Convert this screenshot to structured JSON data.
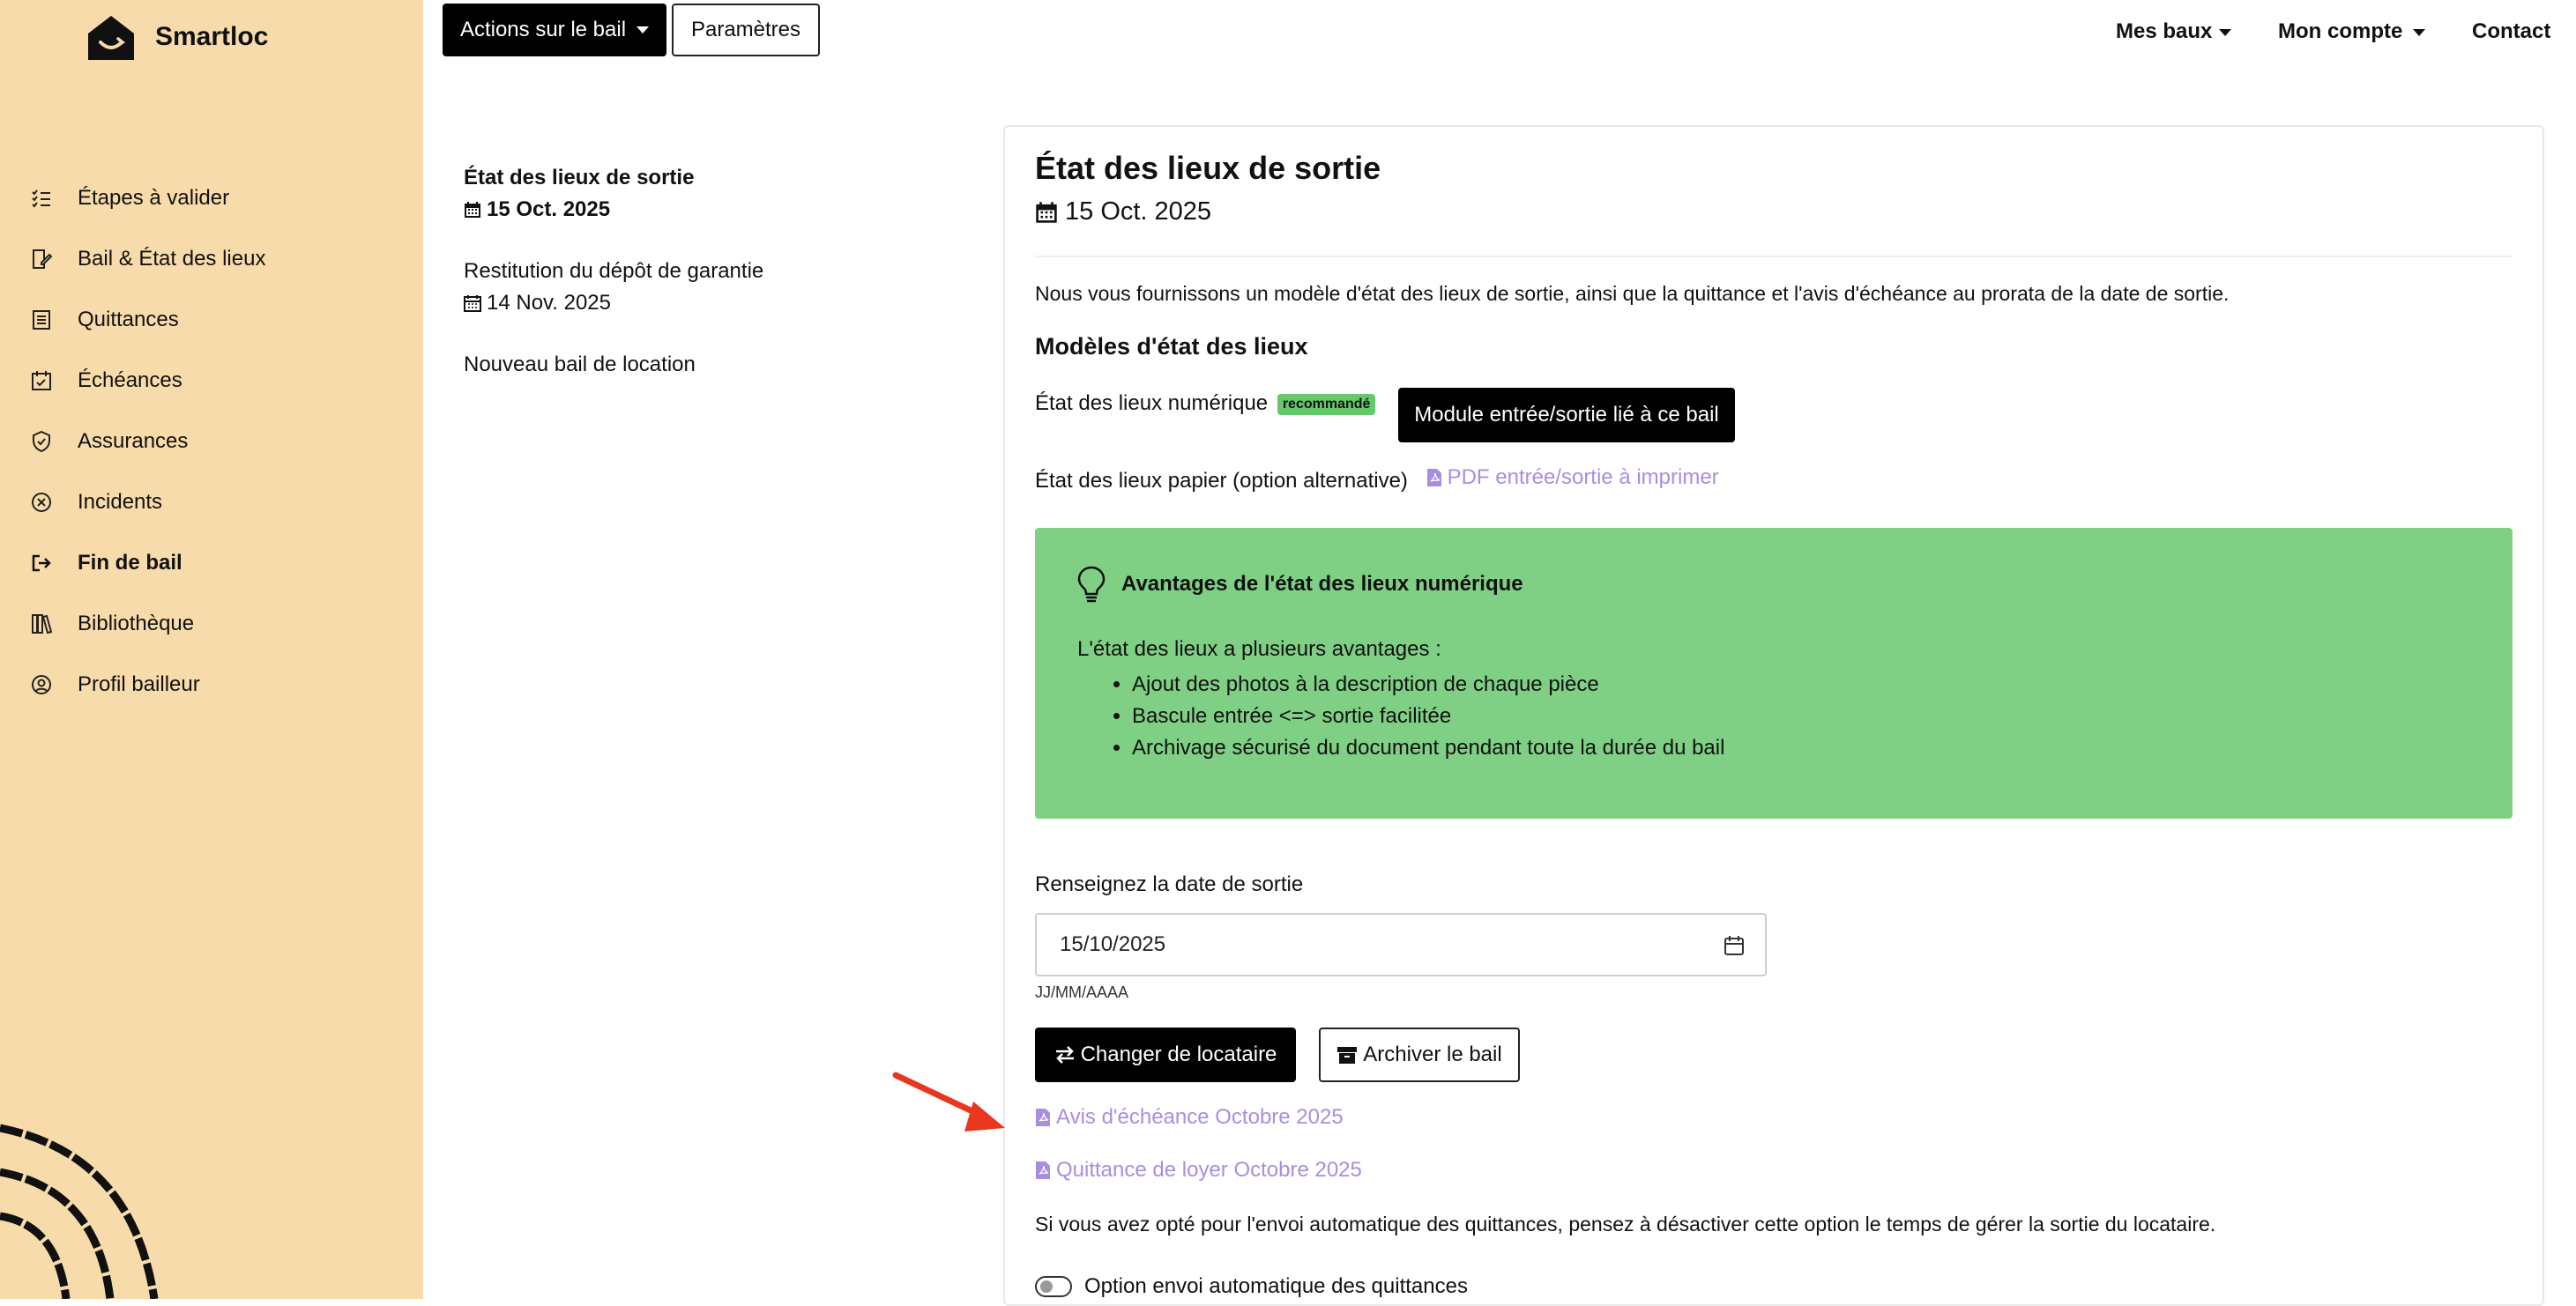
{
  "brand": {
    "name": "Smartloc"
  },
  "sidebar": {
    "items": [
      {
        "label": "Étapes à valider",
        "icon": "checklist-icon"
      },
      {
        "label": "Bail & État des lieux",
        "icon": "edit-document-icon"
      },
      {
        "label": "Quittances",
        "icon": "receipt-icon"
      },
      {
        "label": "Échéances",
        "icon": "calendar-check-icon"
      },
      {
        "label": "Assurances",
        "icon": "shield-icon"
      },
      {
        "label": "Incidents",
        "icon": "x-circle-icon"
      },
      {
        "label": "Fin de bail",
        "icon": "exit-icon",
        "active": true
      },
      {
        "label": "Bibliothèque",
        "icon": "books-icon"
      },
      {
        "label": "Profil bailleur",
        "icon": "user-circle-icon"
      }
    ]
  },
  "toolbar": {
    "actions_label": "Actions sur le bail",
    "params_label": "Paramètres"
  },
  "topnav": {
    "mes_baux": "Mes baux",
    "mon_compte": "Mon compte",
    "contact": "Contact"
  },
  "timeline": {
    "step1_title": "État des lieux de sortie",
    "step1_date": "15 Oct. 2025",
    "step2_title": "Restitution du dépôt de garantie",
    "step2_date": "14 Nov. 2025",
    "step3_title": "Nouveau bail de location"
  },
  "card": {
    "title": "État des lieux de sortie",
    "date": "15 Oct. 2025",
    "intro": "Nous vous fournissons un modèle d'état des lieux de sortie, ainsi que la quittance et l'avis d'échéance au prorata de la date de sortie.",
    "models_heading": "Modèles d'état des lieux",
    "numeric_label": "État des lieux numérique",
    "recommended_badge": "recommandé",
    "module_button": "Module entrée/sortie lié à ce bail",
    "paper_label": "État des lieux papier (option alternative)",
    "paper_link": "PDF entrée/sortie à imprimer",
    "advantages": {
      "title": "Avantages de l'état des lieux numérique",
      "intro": "L'état des lieux a plusieurs avantages :",
      "items": [
        "Ajout des photos à la description de chaque pièce",
        "Bascule entrée <=> sortie facilitée",
        "Archivage sécurisé du document pendant toute la durée du bail"
      ]
    },
    "date_label": "Renseignez la date de sortie",
    "date_value": "15/10/2025",
    "date_hint": "JJ/MM/AAAA",
    "change_tenant_button": "Changer de locataire",
    "archive_button": "Archiver le bail",
    "notice_link": "Avis d'échéance Octobre 2025",
    "receipt_link": "Quittance de loyer Octobre 2025",
    "auto_note": "Si vous avez opté pour l'envoi automatique des quittances, pensez à désactiver cette option le temps de gérer la sortie du locataire.",
    "auto_toggle_label": "Option envoi automatique des quittances"
  },
  "colors": {
    "sidebar_bg": "#f8dbaa",
    "advantages_bg": "#7fcf85",
    "link": "#a98ee0",
    "badge": "#64c96b",
    "annotation_arrow": "#e8361f"
  }
}
